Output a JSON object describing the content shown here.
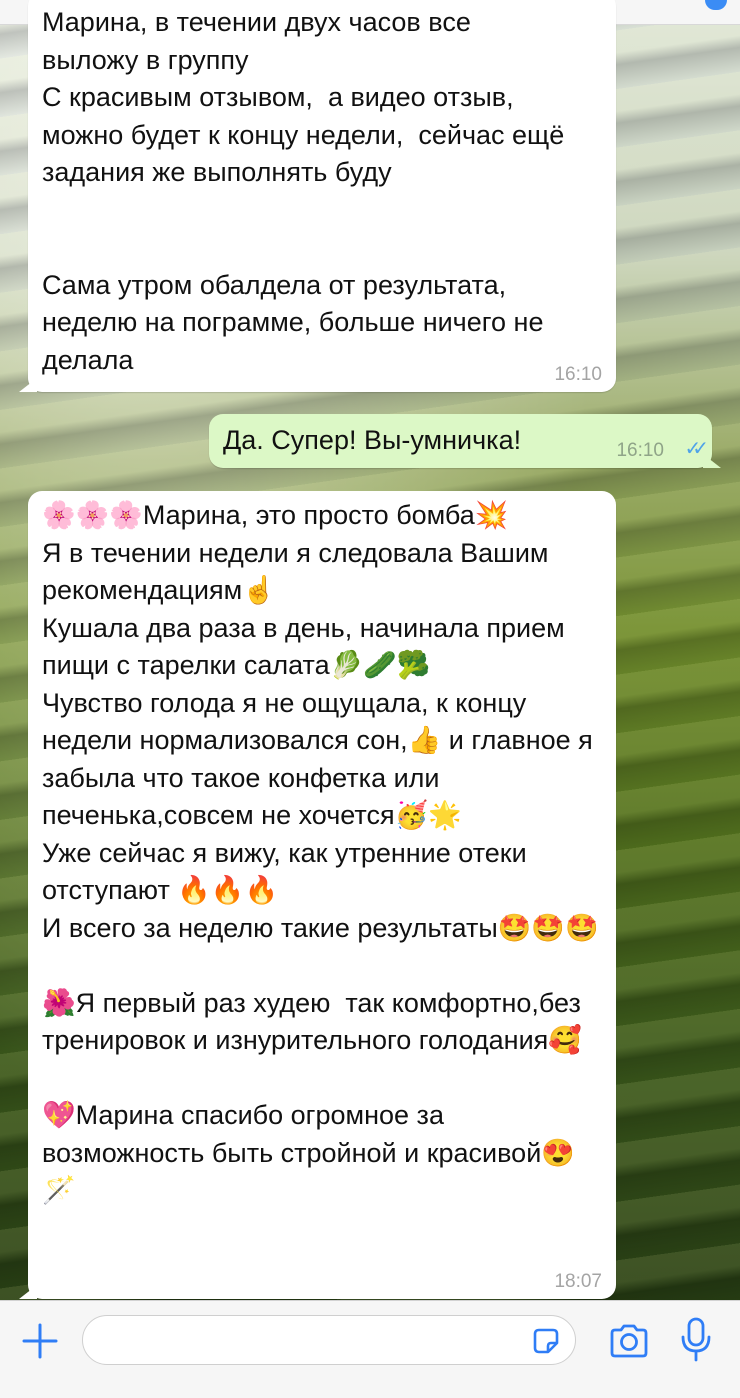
{
  "chat": {
    "messages": [
      {
        "direction": "incoming",
        "text": "Марина, в течении двух часов все\nвыложу в группу\nС красивым отзывом,  а видео отзыв, можно будет к концу недели,  сейчас ещё задания же выполнять буду\n\n\nСама утром обалдела от результата, неделю на пограмме, больше ничего не делала",
        "time": "16:10"
      },
      {
        "direction": "outgoing",
        "text": "Да. Супер! Вы-умничка!",
        "time": "16:10",
        "status": "read"
      },
      {
        "direction": "incoming",
        "text": "🌸🌸🌸Марина, это просто бомба💥\nЯ в течении недели я следовала Вашим рекомендациям☝\nКушала два раза в день, начинала прием пищи с тарелки салата🥬🥒🥦\nЧувство голода я не ощущала, к концу недели нормализовался сон,👍 и главное я забыла что такое конфетка или печенька,совсем не хочется🥳🌟\nУже сейчас я вижу, как утренние отеки отступают 🔥🔥🔥\nИ всего за неделю такие результаты🤩🤩🤩\n\n🌺Я первый раз худею  так комфортно,без тренировок и изнурительного голодания🥰\n\n💖Марина спасибо огромное за возможность быть стройной и красивой😍🪄",
        "time": "18:07"
      }
    ]
  },
  "composer": {
    "placeholder": "",
    "icons": {
      "add": "plus-icon",
      "sticker": "sticker-icon",
      "camera": "camera-icon",
      "mic": "microphone-icon"
    }
  },
  "colors": {
    "incoming_bubble": "#ffffff",
    "outgoing_bubble": "#dcf8c6",
    "accent": "#2f7df6",
    "read_ticks": "#4fa3e8"
  }
}
